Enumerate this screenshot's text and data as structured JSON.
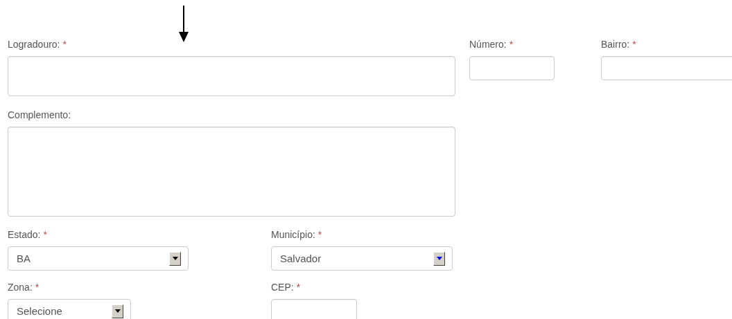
{
  "rows": [
    [
      {
        "label": "Logradouro:",
        "required": true,
        "kind": "text"
      },
      {
        "label": "Número:",
        "required": true,
        "kind": "text"
      },
      {
        "label": "Bairro:",
        "required": true,
        "kind": "text"
      }
    ],
    [
      {
        "label": "Complemento:",
        "required": false,
        "kind": "textarea"
      }
    ],
    [
      {
        "label": "Estado:",
        "required": true,
        "kind": "select",
        "value": "BA",
        "focused": false
      },
      {
        "label": "Município:",
        "required": true,
        "kind": "select",
        "value": "Salvador",
        "focused": true
      }
    ],
    [
      {
        "label": "Zona:",
        "required": true,
        "kind": "select",
        "value": "Selecione",
        "focused": false
      },
      {
        "label": "CEP:",
        "required": true,
        "kind": "text"
      }
    ]
  ],
  "required_mark": "*"
}
